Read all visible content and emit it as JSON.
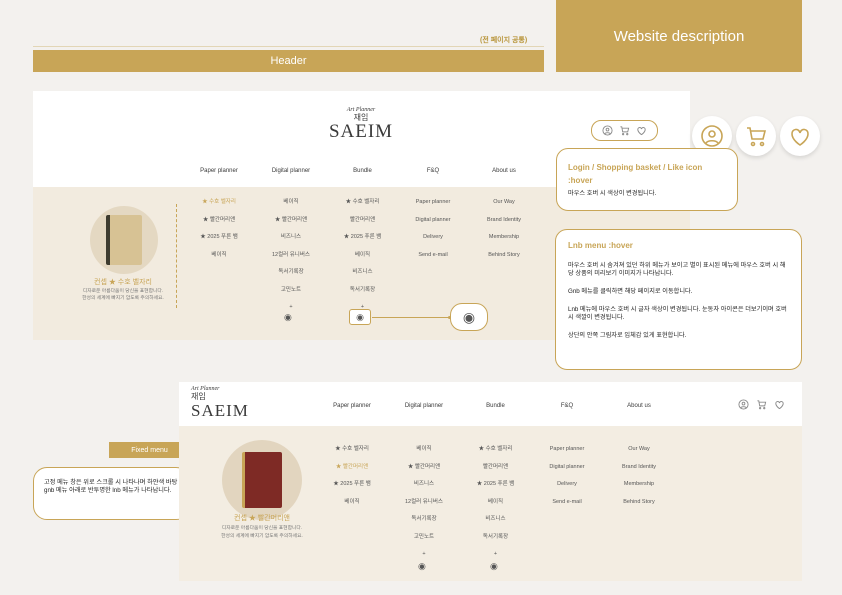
{
  "top": {
    "header_label": "Header",
    "common_note": "(전 페이지 공통)",
    "description_label": "Website description"
  },
  "brand": {
    "small": "Art Planner",
    "mark": "재임",
    "name": "SAEIM"
  },
  "gnb": [
    "Paper planner",
    "Digital planner",
    "Bundle",
    "F&Q",
    "About us"
  ],
  "lnb": {
    "paper": [
      "★ 수호 벨자리",
      "★ 빨간머리앤",
      "★ 2025 푸른 뱀",
      "베이직"
    ],
    "digital": [
      "베이직",
      "★ 빨간머리앤",
      "비즈니스",
      "12컬러 유니버스",
      "독서기록장",
      "고민노트",
      "+"
    ],
    "bundle": [
      "★ 수호 벨자리",
      "빨간머리앤",
      "★ 2025 푸른 뱀",
      "베이직",
      "비즈니스",
      "독서기록장",
      "+"
    ],
    "fnq": [
      "Paper planner",
      "Digital planner",
      "Delivery",
      "Send e-mail"
    ],
    "about": [
      "Our Way",
      "Brand Identity",
      "Membership",
      "Behind Story"
    ]
  },
  "lnb2": {
    "paper": [
      "★ 수호 벨자리",
      "★ 빨간머리앤",
      "★ 2025 푸른 뱀",
      "베이직"
    ],
    "digital": [
      "베이직",
      "★ 빨간머리앤",
      "비즈니스",
      "12컬러 유니버스",
      "독서기록장",
      "고민노트",
      "+"
    ],
    "bundle": [
      "★ 수호 벨자리",
      "빨간머리앤",
      "★ 2025 푸른 뱀",
      "베이직",
      "비즈니스",
      "독서기록장",
      "+"
    ],
    "fnq": [
      "Paper planner",
      "Digital planner",
      "Delivery",
      "Send e-mail"
    ],
    "about": [
      "Our Way",
      "Brand Identity",
      "Membership",
      "Behind Story"
    ]
  },
  "product1": {
    "title": "컨셉 ★ 수호 벨자리",
    "desc1": "디자로운 아름다움이 당신을 표현합니다.",
    "desc2": "한성의 세계에 빠지기 암도록 주의하세요."
  },
  "product2": {
    "title": "컨셉 ★ 빨간머리앤",
    "desc1": "디자로운 아름다움이 당신을 표현합니다.",
    "desc2": "한성의 세계에 빠지기 암도록 주의하세요."
  },
  "callouts": {
    "login_title": "Login / Shopping basket / Like icon :hover",
    "login_body": "마우스 호버 시 색상이 변경됩니다.",
    "lnb_title": "Lnb menu :hover",
    "lnb_p1": "마우스 호버 시 숨겨져 있던 하위 메뉴가 보이고 별이 표시된 메뉴에  마우스 호버 시 해당 상품의 미리보기 이미지가 나타납니다.",
    "lnb_p2": "Gnb 메뉴를 클릭하면 해당 페이지로 이동합니다.",
    "lnb_p3": "Lnb 메뉴에 마우스 호버 시 글자 색상이 변경됩니다. 눈동자 아이콘은 더보기이며 호버 시 색깔이 변경됩니다.",
    "lnb_p4": "상단의 안쪽 그림자로 입체감 있게 표현합니다.",
    "fixed_label": "Fixed menu",
    "fixed_body": "고정 메뉴 창은 위로 스크롤 시 나타나며 하얀색 바탕 gnb 메뉴 아래로 반투명한 lnb 메뉴가 나타납니다."
  },
  "icons": [
    "user-icon",
    "cart-icon",
    "heart-icon",
    "eye-icon"
  ],
  "colors": {
    "accent": "#c8a557",
    "lnb_bg": "#f2ebdf",
    "book_red": "#7e2a25"
  }
}
